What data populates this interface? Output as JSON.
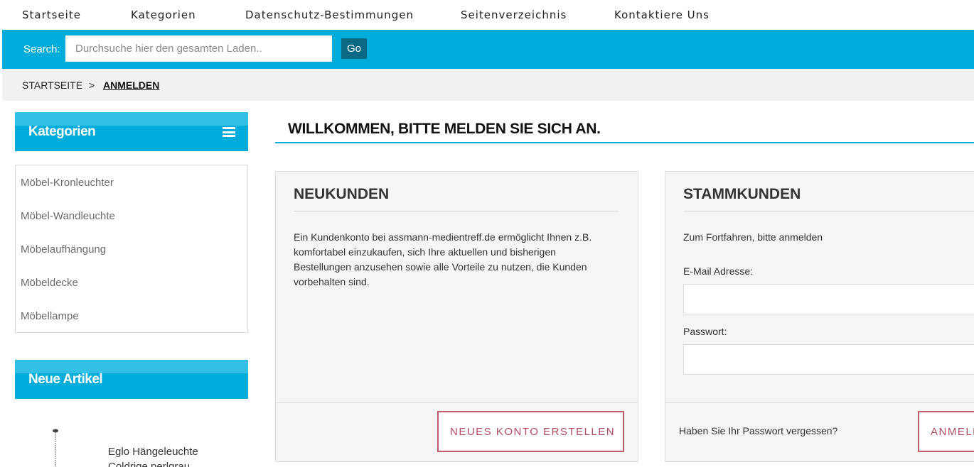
{
  "topnav": {
    "items": [
      "Startseite",
      "Kategorien",
      "Datenschutz-Bestimmungen",
      "Seitenverzeichnis",
      "Kontaktiere Uns"
    ]
  },
  "search": {
    "label": "Search:",
    "placeholder": "Durchsuche hier den gesamten Laden..",
    "button": "Go"
  },
  "breadcrumb": {
    "home": "STARTSEITE",
    "separator": ">",
    "current": "ANMELDEN"
  },
  "sidebar": {
    "categories_title": "Kategorien",
    "categories": [
      "Möbel-Kronleuchter",
      "Möbel-Wandleuchte",
      "Möbelaufhängung",
      "Möbeldecke",
      "Möbellampe"
    ],
    "new_items_title": "Neue Artikel",
    "product_name": "Eglo Hängeleuchte Coldrige perlgrau"
  },
  "main": {
    "title": "WILLKOMMEN, BITTE MELDEN SIE SICH AN.",
    "new_customers": {
      "title": "NEUKUNDEN",
      "text": "Ein Kundenkonto bei assmann-medientreff.de ermöglicht Ihnen z.B. komfortabel einzukaufen, sich Ihre aktuellen und bisherigen Bestellungen anzusehen sowie alle Vorteile zu nutzen, die Kunden vorbehalten sind.",
      "button": "NEUES KONTO ERSTELLEN"
    },
    "returning_customers": {
      "title": "STAMMKUNDEN",
      "intro": "Zum Fortfahren, bitte anmelden",
      "email_label": "E-Mail Adresse:",
      "password_label": "Passwort:",
      "forgot": "Haben Sie Ihr Passwort vergessen?",
      "button": "ANMELDEN"
    }
  },
  "colors": {
    "accent": "#00acd9",
    "button_dark": "#0a6a86",
    "button_outline": "#c05a6e"
  }
}
